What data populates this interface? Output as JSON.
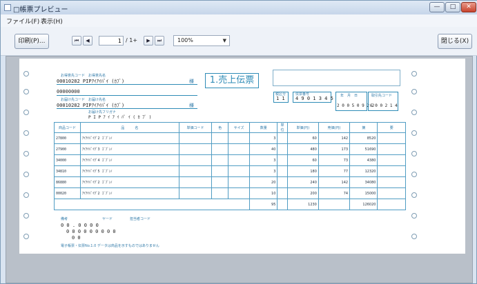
{
  "window": {
    "title": "□帳票プレビュー"
  },
  "menu": {
    "file": "ファイル(F)",
    "view": "表示(H)"
  },
  "toolbar": {
    "print": "印刷(P)...",
    "first": "⏮",
    "prev": "◀",
    "next": "▶",
    "last": "⏭",
    "page_value": "1",
    "page_total": "/ 1+",
    "zoom": "100%",
    "close": "閉じる(X)"
  },
  "form": {
    "title": "1.売上伝票",
    "top_left": {
      "line1_label": "お得意先コード　お得意先名",
      "line1_value": "00010282 PIPｱｲｱｲﾊﾟｲ (ｶﾌﾞ)",
      "line1_suffix": "様",
      "line2_value": "00000000",
      "line3_label": "お届け先コード　お届け先名",
      "line3_value": "00010282 PIPｱｲｱｲﾊﾟｲ (ｶﾌﾞ)",
      "line3_suffix": "様",
      "line4_label": "お届け先フリガナ",
      "line4_value": "P I P ｱ ｲ ｱ ｲ ﾊﾟ ｲ ( ｶ ﾌﾞ )"
    },
    "top_right": {
      "box1_label": "税区分",
      "box1_value": "1 1",
      "box2_label": "伝票番号",
      "box2_value": "4 9 0 1 3 4 5",
      "box3_label": "年　月　日",
      "box3_value": "2 0 0 5 0 9 2 2",
      "box4_label": "取引先コード",
      "box4_value": "6 0 0 2 1 4"
    },
    "headers": [
      "商品コード",
      "品　　　名",
      "",
      "単価コード",
      "色",
      "サイズ",
      "数量",
      "単位",
      "単価(円)",
      "売価(円)",
      "摘",
      "要"
    ],
    "rows": [
      {
        "code": "27800",
        "name": "ｱｲｱｲﾊﾟｲｸﾞ2 ｺﾞﾌﾞﾝﾉ",
        "qty": "3",
        "price": "60",
        "unit": "142",
        "amount": "8520"
      },
      {
        "code": "27900",
        "name": "ｱｲｱｲﾊﾟｲｸﾞ3 ｺﾞﾌﾞﾝﾉ",
        "qty": "40",
        "price": "480",
        "unit": "173",
        "amount": "51690"
      },
      {
        "code": "34000",
        "name": "ｱｲｱｲﾊﾟｲｸﾞ4 ｺﾞﾌﾞﾝﾉ",
        "qty": "3",
        "price": "60",
        "unit": "73",
        "amount": "4380"
      },
      {
        "code": "34810",
        "name": "ｱｲｱｲﾊﾟｲｸﾞ5 ｺﾞﾌﾞﾝﾉ",
        "qty": "3",
        "price": "180",
        "unit": "77",
        "amount": "12320"
      },
      {
        "code": "86880",
        "name": "ｱｲｱｲﾊﾟｲｸﾞ2 ｺﾞﾌﾞﾝﾉ",
        "qty": "20",
        "price": "240",
        "unit": "142",
        "amount": "34080"
      },
      {
        "code": "00020",
        "name": "ｱｲｱｲﾊﾟｲｸﾞ2 ｺﾞﾌﾞﾝﾉ",
        "qty": "10",
        "price": "200",
        "unit": "74",
        "amount": "15000"
      }
    ],
    "totals": {
      "qty": "95",
      "price": "1230",
      "amount": "126020"
    },
    "footer": {
      "label1": "備考",
      "label2": "ヤード　　　　　担当者コード",
      "line1": "0 0 . 0 0 0 0",
      "line2": "0 0 0 0 0 0 0 0 0",
      "line3": "0 0",
      "fineprint": "電子帳票・伝票No.1.0 データは商品を示すものではありません"
    }
  }
}
